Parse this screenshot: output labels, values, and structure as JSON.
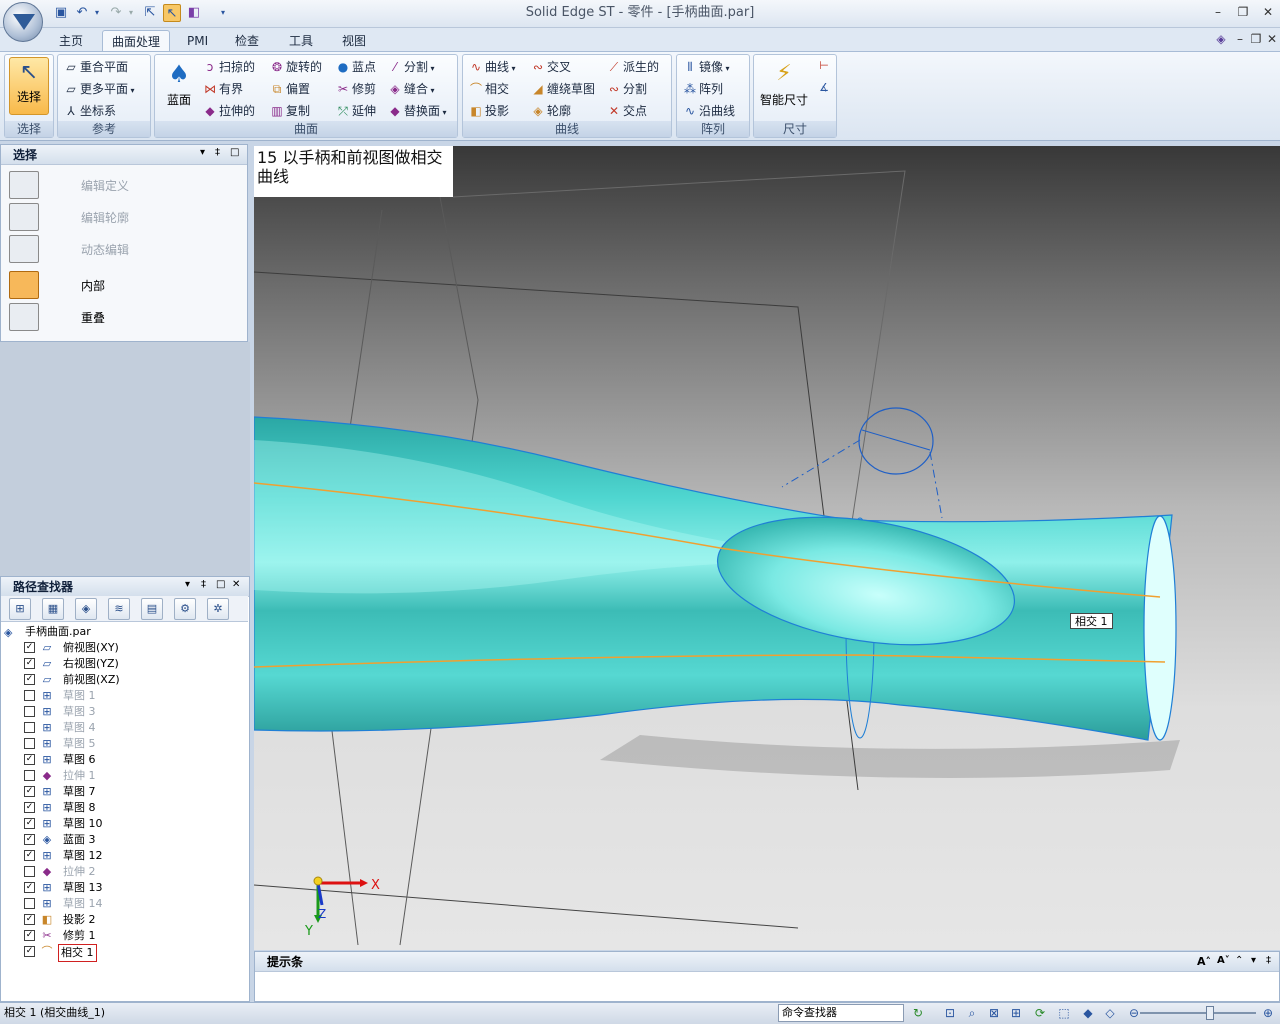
{
  "window": {
    "title": "Solid Edge ST - 零件 - [手柄曲面.par]"
  },
  "qat": {
    "save": "save-icon",
    "undo": "undo-icon",
    "redo": "redo-icon"
  },
  "tabs": [
    {
      "label": "主页"
    },
    {
      "label": "曲面处理"
    },
    {
      "label": "PMI"
    },
    {
      "label": "检查"
    },
    {
      "label": "工具"
    },
    {
      "label": "视图"
    }
  ],
  "ribbon": {
    "select": {
      "label": "选择",
      "group": "选择"
    },
    "reference": {
      "group": "参考",
      "items": [
        "重合平面",
        "更多平面",
        "坐标系"
      ]
    },
    "surface": {
      "group": "曲面",
      "big": "蓝面",
      "items": [
        "扫掠的",
        "旋转的",
        "蓝点",
        "分割",
        "有界",
        "偏置",
        "修剪",
        "缝合",
        "拉伸的",
        "复制",
        "延伸",
        "替换面"
      ]
    },
    "curve": {
      "group": "曲线",
      "items": [
        "曲线",
        "交叉",
        "派生的",
        "相交",
        "缠绕草图",
        "分割",
        "投影",
        "轮廓",
        "交点"
      ]
    },
    "pattern": {
      "group": "阵列",
      "items": [
        "镜像",
        "阵列",
        "沿曲线"
      ]
    },
    "dimension": {
      "group": "尺寸",
      "big": "智能尺寸"
    }
  },
  "select_panel": {
    "title": "选择",
    "items": [
      {
        "label": "编辑定义",
        "enabled": false
      },
      {
        "label": "编辑轮廓",
        "enabled": false
      },
      {
        "label": "动态编辑",
        "enabled": false
      },
      {
        "label": "内部",
        "enabled": true,
        "active": true
      },
      {
        "label": "重叠",
        "enabled": true,
        "active": false
      }
    ]
  },
  "pathfinder": {
    "title": "路径查找器",
    "root": "手柄曲面.par",
    "items": [
      {
        "label": "俯视图(XY)",
        "checked": true,
        "enabled": true,
        "icon": "plane-icon"
      },
      {
        "label": "右视图(YZ)",
        "checked": true,
        "enabled": true,
        "icon": "plane-icon"
      },
      {
        "label": "前视图(XZ)",
        "checked": true,
        "enabled": true,
        "icon": "plane-icon"
      },
      {
        "label": "草图 1",
        "checked": false,
        "enabled": false,
        "icon": "sketch-icon"
      },
      {
        "label": "草图 3",
        "checked": false,
        "enabled": false,
        "icon": "sketch-icon"
      },
      {
        "label": "草图 4",
        "checked": false,
        "enabled": false,
        "icon": "sketch-icon"
      },
      {
        "label": "草图 5",
        "checked": false,
        "enabled": false,
        "icon": "sketch-icon"
      },
      {
        "label": "草图 6",
        "checked": true,
        "enabled": true,
        "icon": "sketch-icon"
      },
      {
        "label": "拉伸 1",
        "checked": false,
        "enabled": false,
        "icon": "extrude-icon"
      },
      {
        "label": "草图 7",
        "checked": true,
        "enabled": true,
        "icon": "sketch-icon"
      },
      {
        "label": "草图 8",
        "checked": true,
        "enabled": true,
        "icon": "sketch-icon"
      },
      {
        "label": "草图 10",
        "checked": true,
        "enabled": true,
        "icon": "sketch-icon"
      },
      {
        "label": "蓝面 3",
        "checked": true,
        "enabled": true,
        "icon": "bluesurf-icon"
      },
      {
        "label": "草图 12",
        "checked": true,
        "enabled": true,
        "icon": "sketch-icon"
      },
      {
        "label": "拉伸 2",
        "checked": false,
        "enabled": false,
        "icon": "extrude-icon"
      },
      {
        "label": "草图 13",
        "checked": true,
        "enabled": true,
        "icon": "sketch-icon"
      },
      {
        "label": "草图 14",
        "checked": false,
        "enabled": false,
        "icon": "sketch-icon"
      },
      {
        "label": "投影 2",
        "checked": true,
        "enabled": true,
        "icon": "project-icon"
      },
      {
        "label": "修剪 1",
        "checked": true,
        "enabled": true,
        "icon": "trim-icon"
      },
      {
        "label": "相交 1",
        "checked": true,
        "enabled": true,
        "icon": "intersect-icon",
        "selected": true
      }
    ]
  },
  "viewport": {
    "note": "15 以手柄和前视图做相交曲线",
    "label": "相交 1",
    "axes": {
      "x": "X",
      "y": "Y",
      "z": "Z"
    }
  },
  "prompt": {
    "title": "提示条"
  },
  "status": {
    "text": "相交 1 (相交曲线_1)",
    "command_finder": "命令查找器"
  }
}
